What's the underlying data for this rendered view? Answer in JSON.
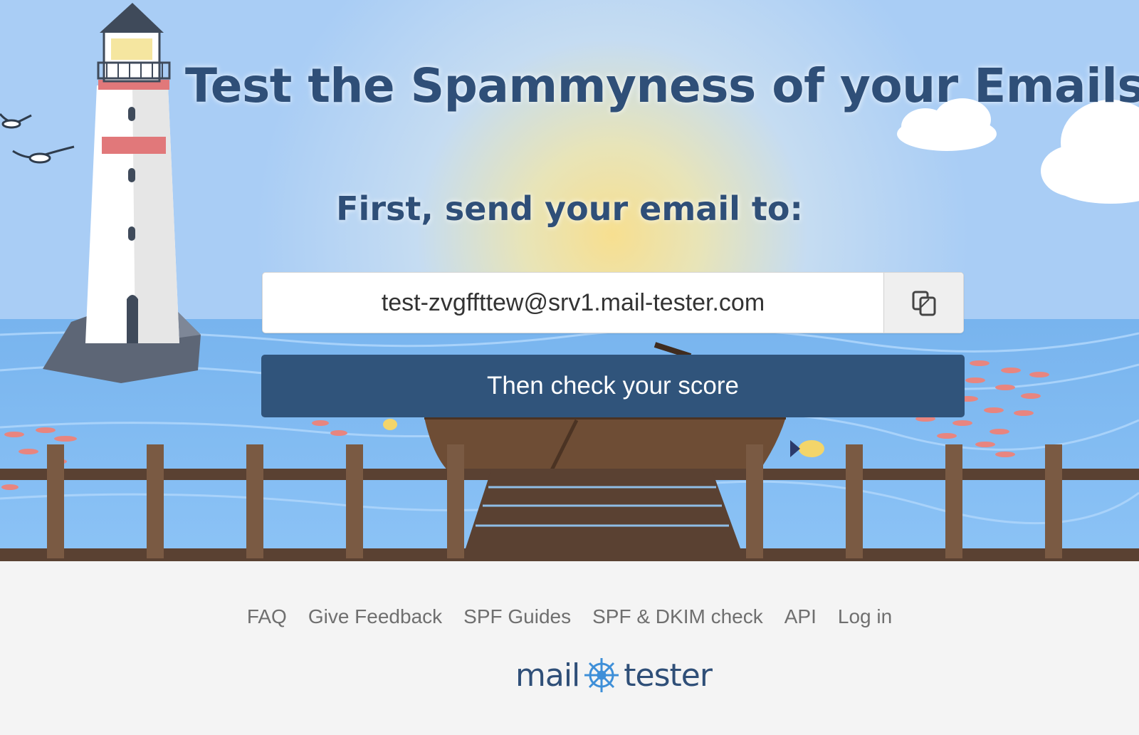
{
  "hero": {
    "headline": "Test the Spammyness of your Emails",
    "subheadline": "First, send your email to:",
    "email_address": "test-zvgffttew@srv1.mail-tester.com",
    "check_button_label": "Then check your score"
  },
  "footer": {
    "links": [
      "FAQ",
      "Give Feedback",
      "SPF Guides",
      "SPF & DKIM check",
      "API",
      "Log in"
    ],
    "brand_left": "mail",
    "brand_right": "tester"
  },
  "colors": {
    "primary": "#30547b",
    "headline_text": "#2f4f78",
    "footer_bg": "#f4f4f4"
  }
}
